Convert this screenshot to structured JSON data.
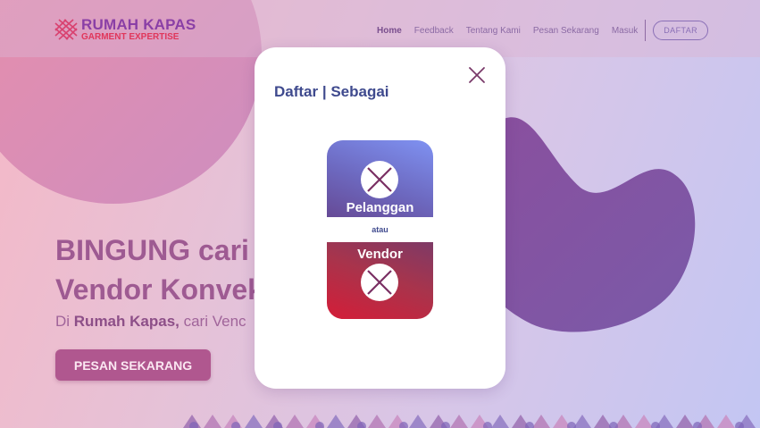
{
  "brand": {
    "title": "RUMAH KAPAS",
    "subtitle": "GARMENT EXPERTISE",
    "logo_icon": "crosshatch-logo-icon"
  },
  "nav": {
    "items": [
      {
        "label": "Home",
        "active": true
      },
      {
        "label": "Feedback",
        "active": false
      },
      {
        "label": "Tentang Kami",
        "active": false
      },
      {
        "label": "Pesan Sekarang",
        "active": false
      },
      {
        "label": "Masuk",
        "active": false
      }
    ],
    "register_label": "DAFTAR"
  },
  "hero": {
    "line1": "BINGUNG cari",
    "line2": "Vendor Konvek",
    "sub_prefix": "Di ",
    "sub_brand": "Rumah Kapas,",
    "sub_suffix": " cari Venc",
    "cta_label": "PESAN SEKARANG"
  },
  "modal": {
    "title": "Daftar | Sebagai",
    "close_icon": "close-icon",
    "options": [
      {
        "label": "Pelanggan",
        "icon": "x-circle-icon"
      },
      {
        "label": "Vendor",
        "icon": "x-circle-icon"
      }
    ],
    "separator": "atau"
  },
  "colors": {
    "accent": "#9e5a92",
    "modal_title": "#3f4a8e",
    "cta": "#b0578f",
    "pelanggan_card": "#6d69c0",
    "vendor_card": "#d41d38"
  }
}
